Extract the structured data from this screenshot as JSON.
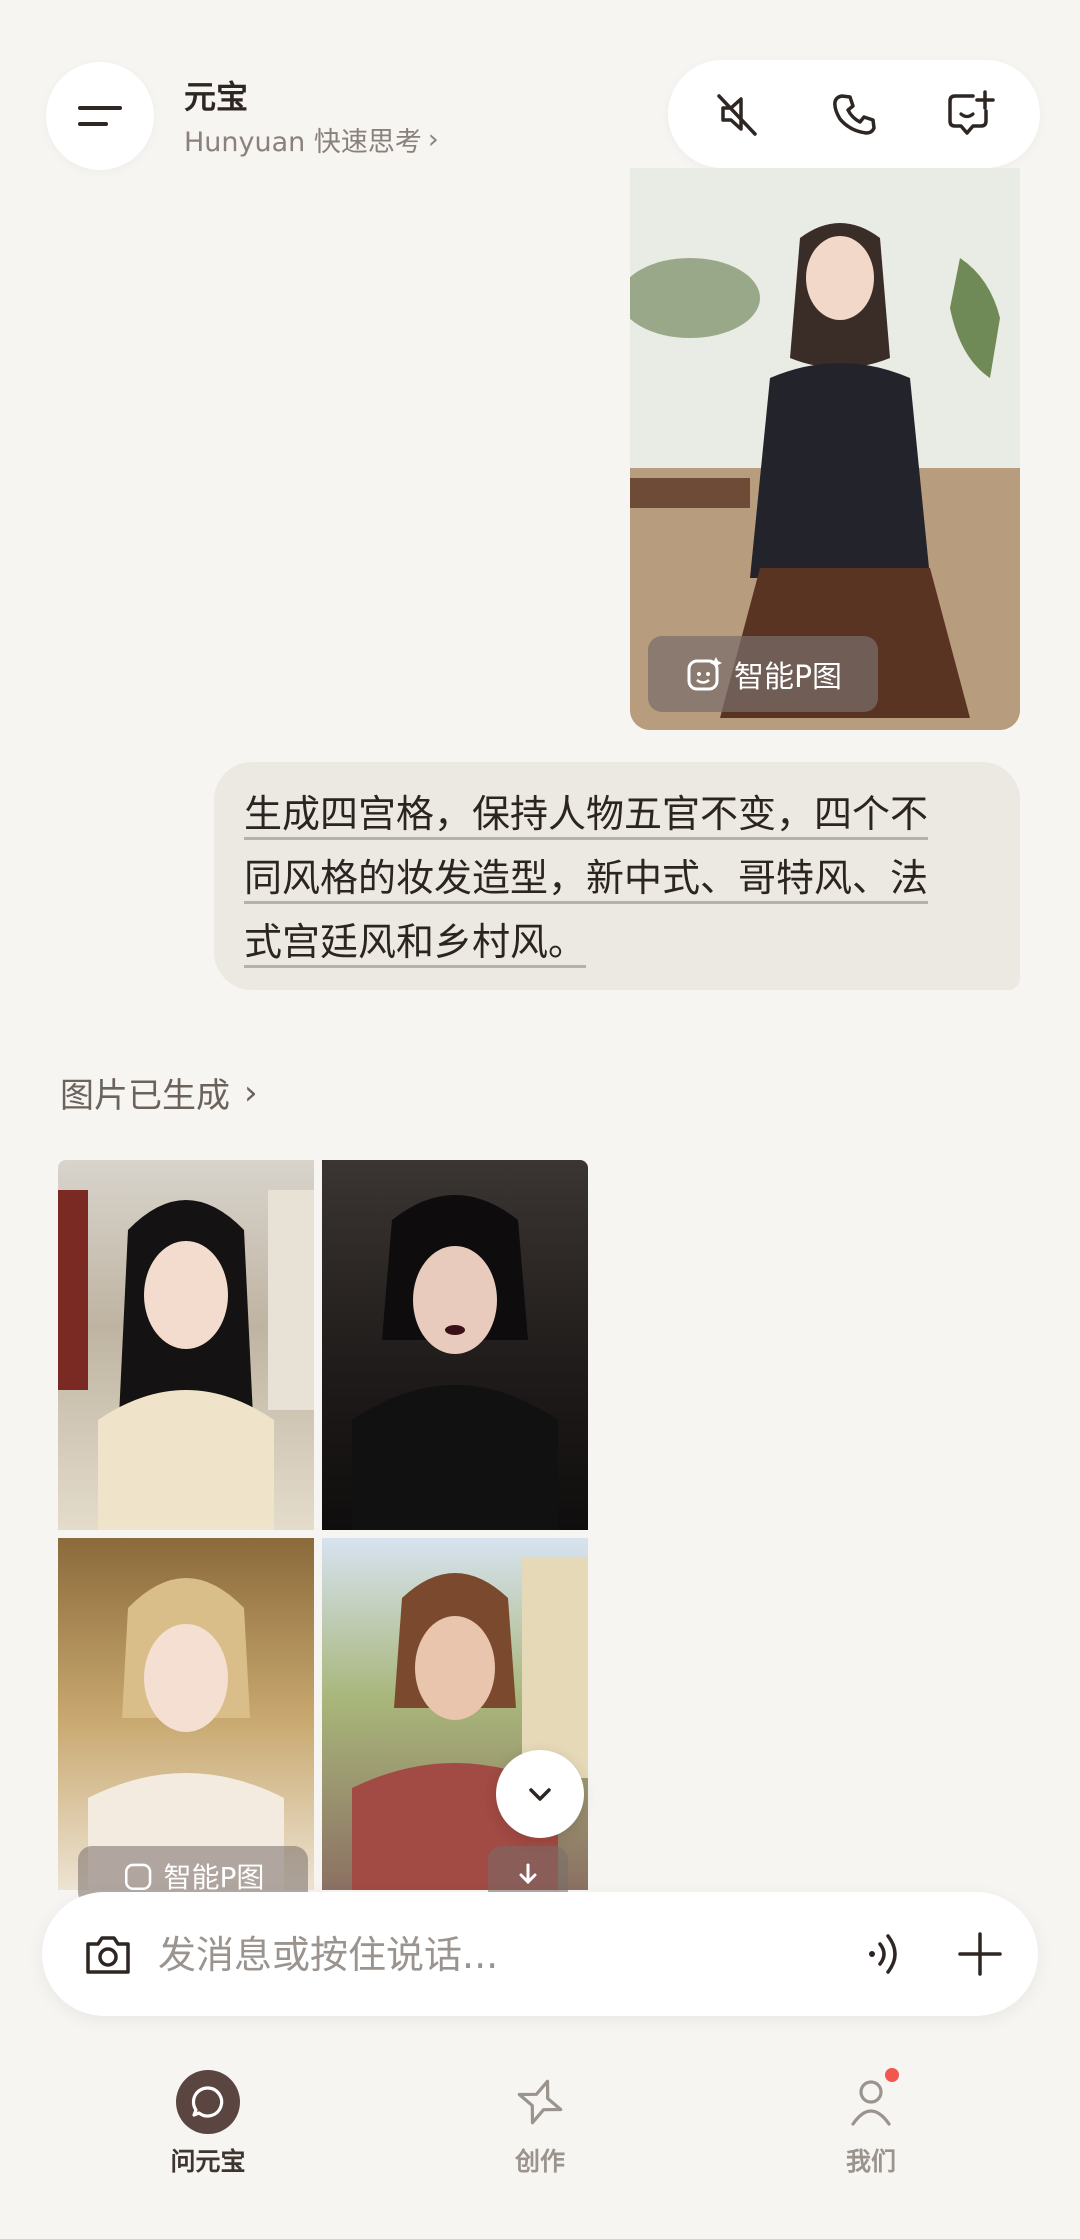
{
  "header": {
    "app_name": "元宝",
    "model_label": "Hunyuan 快速思考",
    "model_chevron": "›"
  },
  "header_actions": {
    "mute_icon": "speaker-muted-icon",
    "call_icon": "phone-icon",
    "new_chat_icon": "new-chat-icon"
  },
  "user_photo": {
    "smart_p_label": "智能P图"
  },
  "user_message": {
    "line1": "生成四宫格，保持人物五官不变，四个不",
    "line2": "同风格的妆发造型，新中式、哥特风、法",
    "line3": "式宫廷风和乡村风。"
  },
  "generated": {
    "header_label": "图片已生成",
    "chevron": "›",
    "smart_p_label": "智能P图"
  },
  "input": {
    "placeholder": "发消息或按住说话..."
  },
  "tabs": [
    {
      "label": "问元宝",
      "active": true
    },
    {
      "label": "创作",
      "active": false
    },
    {
      "label": "我们",
      "active": false,
      "badge": true
    }
  ],
  "colors": {
    "background": "#f7f5f1",
    "bubble": "#ece8e2",
    "active_tab": "#5a4541",
    "badge": "#f0584f"
  }
}
